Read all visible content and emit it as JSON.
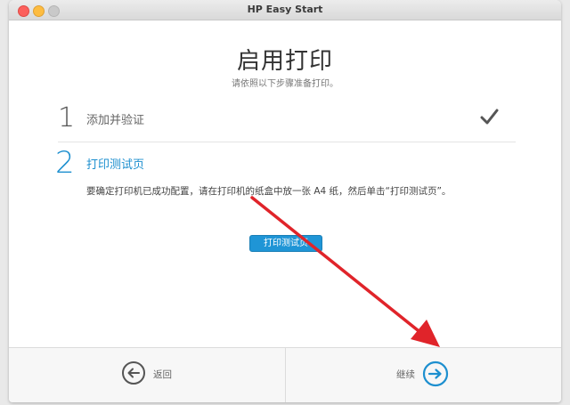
{
  "window": {
    "title": "HP Easy Start"
  },
  "header": {
    "title": "启用打印",
    "subtitle": "请依照以下步骤准备打印。"
  },
  "steps": [
    {
      "number": "1",
      "label": "添加并验证",
      "status": "complete"
    },
    {
      "number": "2",
      "label": "打印测试页",
      "status": "active",
      "instructions": "要确定打印机已成功配置，请在打印机的纸盒中放一张 A4 纸，然后单击“打印测试页”。",
      "button_label": "打印测试页"
    }
  ],
  "footer": {
    "back_label": "返回",
    "continue_label": "继续"
  },
  "colors": {
    "accent": "#1d8fcf",
    "annotation_arrow": "#e0242a"
  },
  "icons": {
    "step1_status": "checkmark-icon",
    "back": "circle-arrow-left-icon",
    "continue": "circle-arrow-right-icon"
  }
}
